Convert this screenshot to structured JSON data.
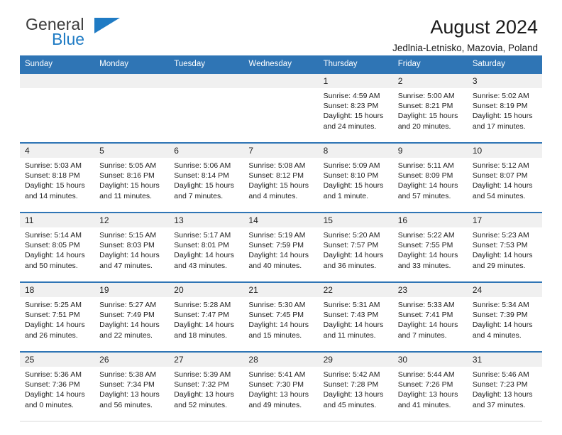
{
  "brand": {
    "name_part1": "General",
    "name_part2": "Blue",
    "logo_icon": "blue-triangle-icon",
    "color_dark": "#3c3c3c",
    "color_blue": "#1f7bc4"
  },
  "header": {
    "title": "August 2024",
    "subtitle": "Jedlnia-Letnisko, Mazovia, Poland",
    "accent_color": "#2f75b5",
    "daynum_band_color": "#f0f0f0"
  },
  "weekdays": [
    "Sunday",
    "Monday",
    "Tuesday",
    "Wednesday",
    "Thursday",
    "Friday",
    "Saturday"
  ],
  "labels": {
    "sunrise": "Sunrise:",
    "sunset": "Sunset:",
    "daylight": "Daylight:"
  },
  "weeks": [
    [
      {
        "day": "",
        "l1": "",
        "l2": "",
        "l3": "",
        "l4": ""
      },
      {
        "day": "",
        "l1": "",
        "l2": "",
        "l3": "",
        "l4": ""
      },
      {
        "day": "",
        "l1": "",
        "l2": "",
        "l3": "",
        "l4": ""
      },
      {
        "day": "",
        "l1": "",
        "l2": "",
        "l3": "",
        "l4": ""
      },
      {
        "day": "1",
        "l1": "Sunrise: 4:59 AM",
        "l2": "Sunset: 8:23 PM",
        "l3": "Daylight: 15 hours",
        "l4": "and 24 minutes."
      },
      {
        "day": "2",
        "l1": "Sunrise: 5:00 AM",
        "l2": "Sunset: 8:21 PM",
        "l3": "Daylight: 15 hours",
        "l4": "and 20 minutes."
      },
      {
        "day": "3",
        "l1": "Sunrise: 5:02 AM",
        "l2": "Sunset: 8:19 PM",
        "l3": "Daylight: 15 hours",
        "l4": "and 17 minutes."
      }
    ],
    [
      {
        "day": "4",
        "l1": "Sunrise: 5:03 AM",
        "l2": "Sunset: 8:18 PM",
        "l3": "Daylight: 15 hours",
        "l4": "and 14 minutes."
      },
      {
        "day": "5",
        "l1": "Sunrise: 5:05 AM",
        "l2": "Sunset: 8:16 PM",
        "l3": "Daylight: 15 hours",
        "l4": "and 11 minutes."
      },
      {
        "day": "6",
        "l1": "Sunrise: 5:06 AM",
        "l2": "Sunset: 8:14 PM",
        "l3": "Daylight: 15 hours",
        "l4": "and 7 minutes."
      },
      {
        "day": "7",
        "l1": "Sunrise: 5:08 AM",
        "l2": "Sunset: 8:12 PM",
        "l3": "Daylight: 15 hours",
        "l4": "and 4 minutes."
      },
      {
        "day": "8",
        "l1": "Sunrise: 5:09 AM",
        "l2": "Sunset: 8:10 PM",
        "l3": "Daylight: 15 hours",
        "l4": "and 1 minute."
      },
      {
        "day": "9",
        "l1": "Sunrise: 5:11 AM",
        "l2": "Sunset: 8:09 PM",
        "l3": "Daylight: 14 hours",
        "l4": "and 57 minutes."
      },
      {
        "day": "10",
        "l1": "Sunrise: 5:12 AM",
        "l2": "Sunset: 8:07 PM",
        "l3": "Daylight: 14 hours",
        "l4": "and 54 minutes."
      }
    ],
    [
      {
        "day": "11",
        "l1": "Sunrise: 5:14 AM",
        "l2": "Sunset: 8:05 PM",
        "l3": "Daylight: 14 hours",
        "l4": "and 50 minutes."
      },
      {
        "day": "12",
        "l1": "Sunrise: 5:15 AM",
        "l2": "Sunset: 8:03 PM",
        "l3": "Daylight: 14 hours",
        "l4": "and 47 minutes."
      },
      {
        "day": "13",
        "l1": "Sunrise: 5:17 AM",
        "l2": "Sunset: 8:01 PM",
        "l3": "Daylight: 14 hours",
        "l4": "and 43 minutes."
      },
      {
        "day": "14",
        "l1": "Sunrise: 5:19 AM",
        "l2": "Sunset: 7:59 PM",
        "l3": "Daylight: 14 hours",
        "l4": "and 40 minutes."
      },
      {
        "day": "15",
        "l1": "Sunrise: 5:20 AM",
        "l2": "Sunset: 7:57 PM",
        "l3": "Daylight: 14 hours",
        "l4": "and 36 minutes."
      },
      {
        "day": "16",
        "l1": "Sunrise: 5:22 AM",
        "l2": "Sunset: 7:55 PM",
        "l3": "Daylight: 14 hours",
        "l4": "and 33 minutes."
      },
      {
        "day": "17",
        "l1": "Sunrise: 5:23 AM",
        "l2": "Sunset: 7:53 PM",
        "l3": "Daylight: 14 hours",
        "l4": "and 29 minutes."
      }
    ],
    [
      {
        "day": "18",
        "l1": "Sunrise: 5:25 AM",
        "l2": "Sunset: 7:51 PM",
        "l3": "Daylight: 14 hours",
        "l4": "and 26 minutes."
      },
      {
        "day": "19",
        "l1": "Sunrise: 5:27 AM",
        "l2": "Sunset: 7:49 PM",
        "l3": "Daylight: 14 hours",
        "l4": "and 22 minutes."
      },
      {
        "day": "20",
        "l1": "Sunrise: 5:28 AM",
        "l2": "Sunset: 7:47 PM",
        "l3": "Daylight: 14 hours",
        "l4": "and 18 minutes."
      },
      {
        "day": "21",
        "l1": "Sunrise: 5:30 AM",
        "l2": "Sunset: 7:45 PM",
        "l3": "Daylight: 14 hours",
        "l4": "and 15 minutes."
      },
      {
        "day": "22",
        "l1": "Sunrise: 5:31 AM",
        "l2": "Sunset: 7:43 PM",
        "l3": "Daylight: 14 hours",
        "l4": "and 11 minutes."
      },
      {
        "day": "23",
        "l1": "Sunrise: 5:33 AM",
        "l2": "Sunset: 7:41 PM",
        "l3": "Daylight: 14 hours",
        "l4": "and 7 minutes."
      },
      {
        "day": "24",
        "l1": "Sunrise: 5:34 AM",
        "l2": "Sunset: 7:39 PM",
        "l3": "Daylight: 14 hours",
        "l4": "and 4 minutes."
      }
    ],
    [
      {
        "day": "25",
        "l1": "Sunrise: 5:36 AM",
        "l2": "Sunset: 7:36 PM",
        "l3": "Daylight: 14 hours",
        "l4": "and 0 minutes."
      },
      {
        "day": "26",
        "l1": "Sunrise: 5:38 AM",
        "l2": "Sunset: 7:34 PM",
        "l3": "Daylight: 13 hours",
        "l4": "and 56 minutes."
      },
      {
        "day": "27",
        "l1": "Sunrise: 5:39 AM",
        "l2": "Sunset: 7:32 PM",
        "l3": "Daylight: 13 hours",
        "l4": "and 52 minutes."
      },
      {
        "day": "28",
        "l1": "Sunrise: 5:41 AM",
        "l2": "Sunset: 7:30 PM",
        "l3": "Daylight: 13 hours",
        "l4": "and 49 minutes."
      },
      {
        "day": "29",
        "l1": "Sunrise: 5:42 AM",
        "l2": "Sunset: 7:28 PM",
        "l3": "Daylight: 13 hours",
        "l4": "and 45 minutes."
      },
      {
        "day": "30",
        "l1": "Sunrise: 5:44 AM",
        "l2": "Sunset: 7:26 PM",
        "l3": "Daylight: 13 hours",
        "l4": "and 41 minutes."
      },
      {
        "day": "31",
        "l1": "Sunrise: 5:46 AM",
        "l2": "Sunset: 7:23 PM",
        "l3": "Daylight: 13 hours",
        "l4": "and 37 minutes."
      }
    ]
  ]
}
